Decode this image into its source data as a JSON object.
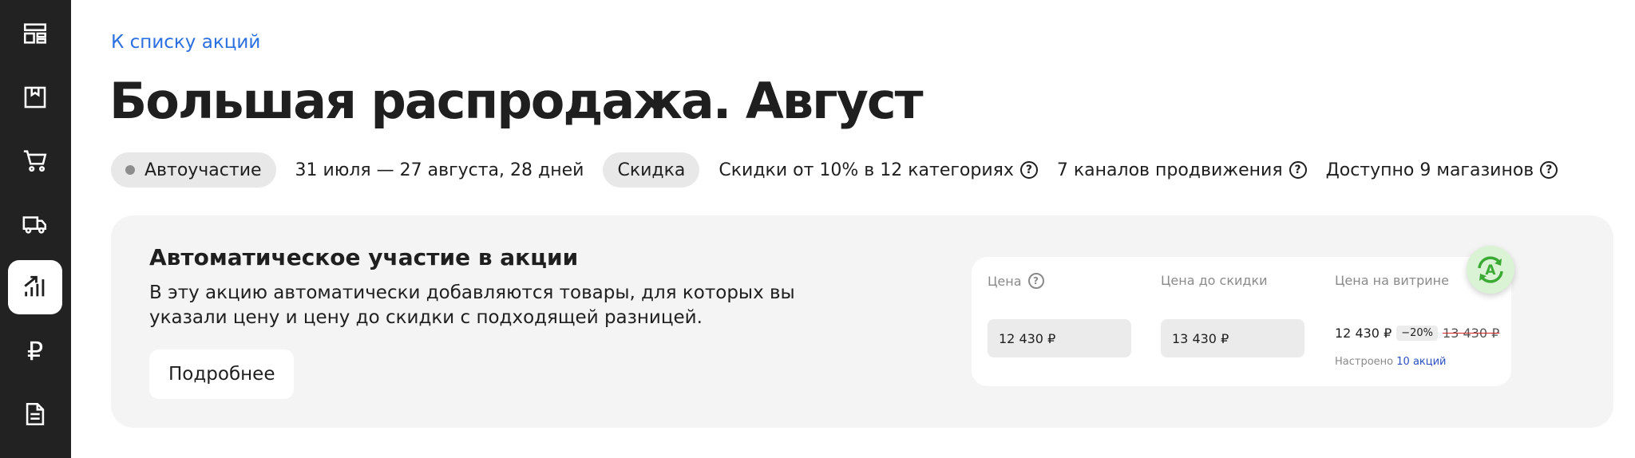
{
  "sidebar": {
    "items": [
      {
        "icon": "dashboard-icon"
      },
      {
        "icon": "box-icon"
      },
      {
        "icon": "cart-icon"
      },
      {
        "icon": "truck-icon"
      },
      {
        "icon": "analytics-icon",
        "active": true
      },
      {
        "icon": "ruble-icon",
        "glyph": "₽"
      },
      {
        "icon": "document-icon"
      }
    ]
  },
  "header": {
    "back_link": "К списку акций",
    "title": "Большая распродажа. Август"
  },
  "meta": {
    "status_chip": "Автоучастие",
    "dates": "31 июля — 27 августа, 28 дней",
    "type_chip": "Скидка",
    "discounts": "Скидки от 10% в 12 категориях",
    "channels": "7 каналов продвижения",
    "stores": "Доступно 9 магазинов",
    "help_glyph": "?"
  },
  "promo": {
    "title": "Автоматическое участие в акции",
    "description": "В эту акцию автоматически добавляются товары, для которых вы указали цену и цену до скидки с подходящей разницей.",
    "more_button": "Подробнее",
    "widget": {
      "price_label": "Цена",
      "price_before_label": "Цена до скидки",
      "showcase_label": "Цена на витрине",
      "price_value": "12 430 ₽",
      "price_before_value": "13 430 ₽",
      "showcase_price": "12 430 ₽",
      "discount": "−20%",
      "old_price": "13 430 ₽",
      "configured_text": "Настроено",
      "configured_link": "10 акций",
      "badge_letter": "A"
    }
  },
  "colors": {
    "sidebar_bg": "#222222",
    "link": "#2c6fe0",
    "card_bg": "#f4f4f4",
    "badge_green": "#3aaa35"
  }
}
